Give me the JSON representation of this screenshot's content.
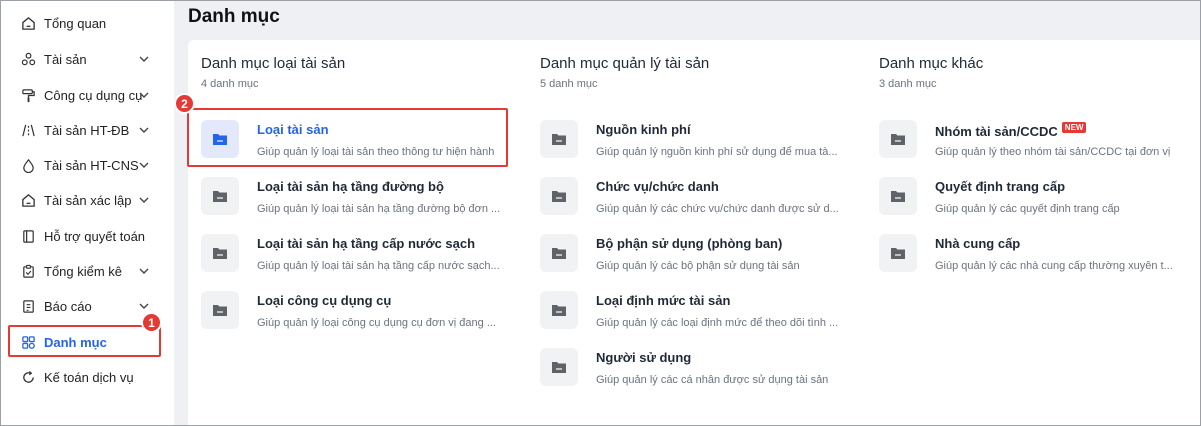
{
  "sidebar": {
    "items": [
      {
        "label": "Tổng quan",
        "icon": "home-icon",
        "chevron": false
      },
      {
        "label": "Tài sản",
        "icon": "assets-icon",
        "chevron": true
      },
      {
        "label": "Công cụ dụng cụ",
        "icon": "paint-roller-icon",
        "chevron": true
      },
      {
        "label": "Tài sản HT-ĐB",
        "icon": "road-icon",
        "chevron": true
      },
      {
        "label": "Tài sản HT-CNS",
        "icon": "water-drop-icon",
        "chevron": true
      },
      {
        "label": "Tài sản xác lập",
        "icon": "home-icon",
        "chevron": true
      },
      {
        "label": "Hỗ trợ quyết toán",
        "icon": "book-icon",
        "chevron": false
      },
      {
        "label": "Tổng kiểm kê",
        "icon": "clipboard-icon",
        "chevron": true
      },
      {
        "label": "Báo cáo",
        "icon": "report-icon",
        "chevron": true
      },
      {
        "label": "Danh mục",
        "icon": "grid-icon",
        "chevron": false,
        "active": true
      },
      {
        "label": "Kế toán dịch vụ",
        "icon": "refresh-icon",
        "chevron": false
      }
    ]
  },
  "annotations": {
    "step1": "1",
    "step2": "2"
  },
  "main": {
    "title": "Danh mục",
    "columns": [
      {
        "title": "Danh mục loại tài sản",
        "count": "4 danh mục",
        "items": [
          {
            "name": "Loại tài sản",
            "desc": "Giúp quản lý loại tài sản theo thông tư hiện hành",
            "selected": true
          },
          {
            "name": "Loại tài sản hạ tầng đường bộ",
            "desc": "Giúp quản lý loại tài sản hạ tầng đường bộ đơn ..."
          },
          {
            "name": "Loại tài sản hạ tầng cấp nước sạch",
            "desc": "Giúp quản lý loại tài sản hạ tầng cấp nước sạch..."
          },
          {
            "name": "Loại công cụ dụng cụ",
            "desc": "Giúp quản lý loại công cụ dụng cụ đơn vị đang ..."
          }
        ]
      },
      {
        "title": "Danh mục quản lý tài sản",
        "count": "5 danh mục",
        "items": [
          {
            "name": "Nguồn kinh phí",
            "desc": "Giúp quản lý nguồn kinh phí sử dụng để mua tà..."
          },
          {
            "name": "Chức vụ/chức danh",
            "desc": "Giúp quản lý các chức vụ/chức danh được sử d..."
          },
          {
            "name": "Bộ phận sử dụng (phòng ban)",
            "desc": "Giúp quản lý các bộ phận sử dụng tài sản"
          },
          {
            "name": "Loại định mức tài sản",
            "desc": "Giúp quản lý các loại định mức để theo dõi tình ..."
          },
          {
            "name": "Người sử dụng",
            "desc": "Giúp quản lý các cá nhân được sử dụng tài sản"
          }
        ]
      },
      {
        "title": "Danh mục khác",
        "count": "3 danh mục",
        "items": [
          {
            "name": "Nhóm tài sản/CCDC",
            "desc": "Giúp quản lý theo nhóm tài sản/CCDC tại đơn vị",
            "badge": "NEW"
          },
          {
            "name": "Quyết định trang cấp",
            "desc": "Giúp quản lý các quyết định trang cấp"
          },
          {
            "name": "Nhà cung cấp",
            "desc": "Giúp quản lý các nhà cung cấp thường xuyên t..."
          }
        ]
      }
    ]
  },
  "colors": {
    "accent": "#2563eb",
    "highlight": "#e53935"
  }
}
